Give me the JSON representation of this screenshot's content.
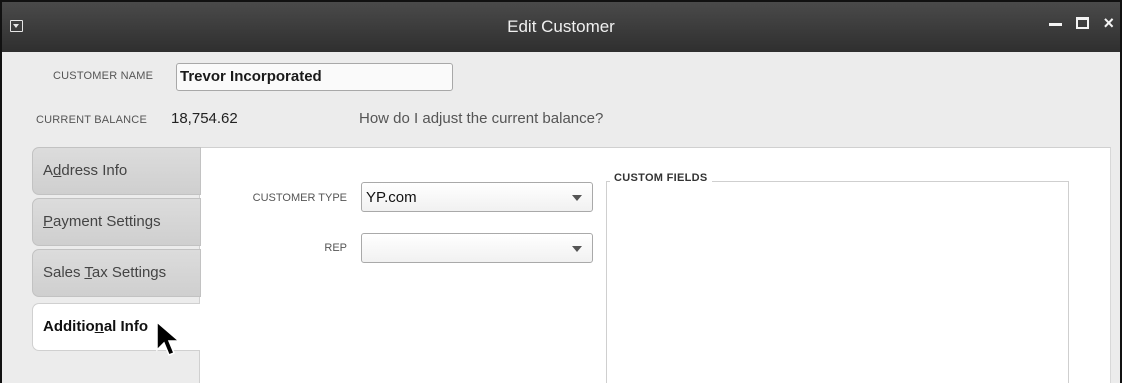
{
  "window": {
    "title": "Edit Customer",
    "controls": {
      "minimize": "–",
      "maximize": "□",
      "close": "×"
    }
  },
  "customer": {
    "name_label": "CUSTOMER NAME",
    "name_value": "Trevor Incorporated",
    "balance_label": "CURRENT BALANCE",
    "balance_value": "18,754.62",
    "adjust_link": "How do I adjust the current balance?"
  },
  "tabs": [
    {
      "label_before": "A",
      "mnemonic": "d",
      "label_after": "dress Info",
      "active": false
    },
    {
      "label_before": "",
      "mnemonic": "P",
      "label_after": "ayment Settings",
      "active": false
    },
    {
      "label_before": "Sales ",
      "mnemonic": "T",
      "label_after": "ax Settings",
      "active": false
    },
    {
      "label_before": "Additio",
      "mnemonic": "n",
      "label_after": "al Info",
      "active": true
    }
  ],
  "additional_info": {
    "customer_type_label": "CUSTOMER TYPE",
    "customer_type_value": "YP.com",
    "rep_label": "REP",
    "rep_value": "",
    "custom_fields_title": "CUSTOM FIELDS"
  },
  "icons": {
    "system_menu": "dropdown-box-icon",
    "cursor": "mouse-pointer-icon"
  }
}
